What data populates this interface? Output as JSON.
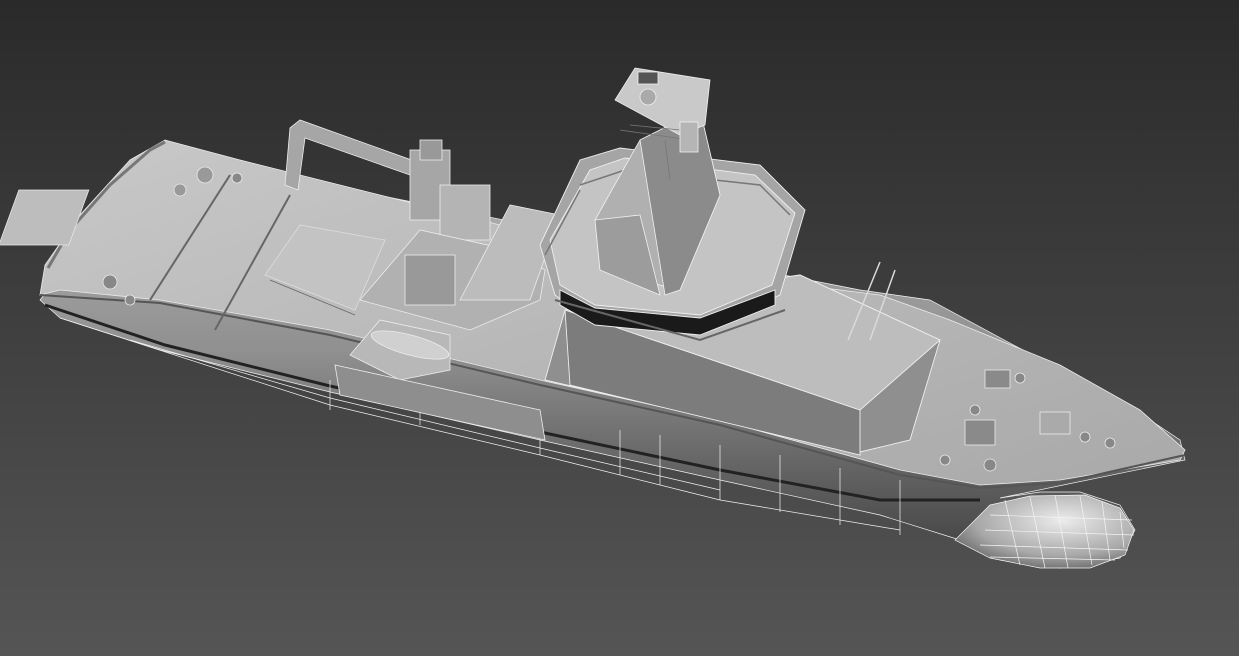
{
  "viewport": {
    "background_top": "#2a2a2a",
    "background_bottom": "#555555",
    "model_fill": "#9c9c9c",
    "model_light": "#cfcfcf",
    "model_dark": "#4a4a4a",
    "wire_color": "#ffffff",
    "shadow_color": "#1e1e1e"
  }
}
